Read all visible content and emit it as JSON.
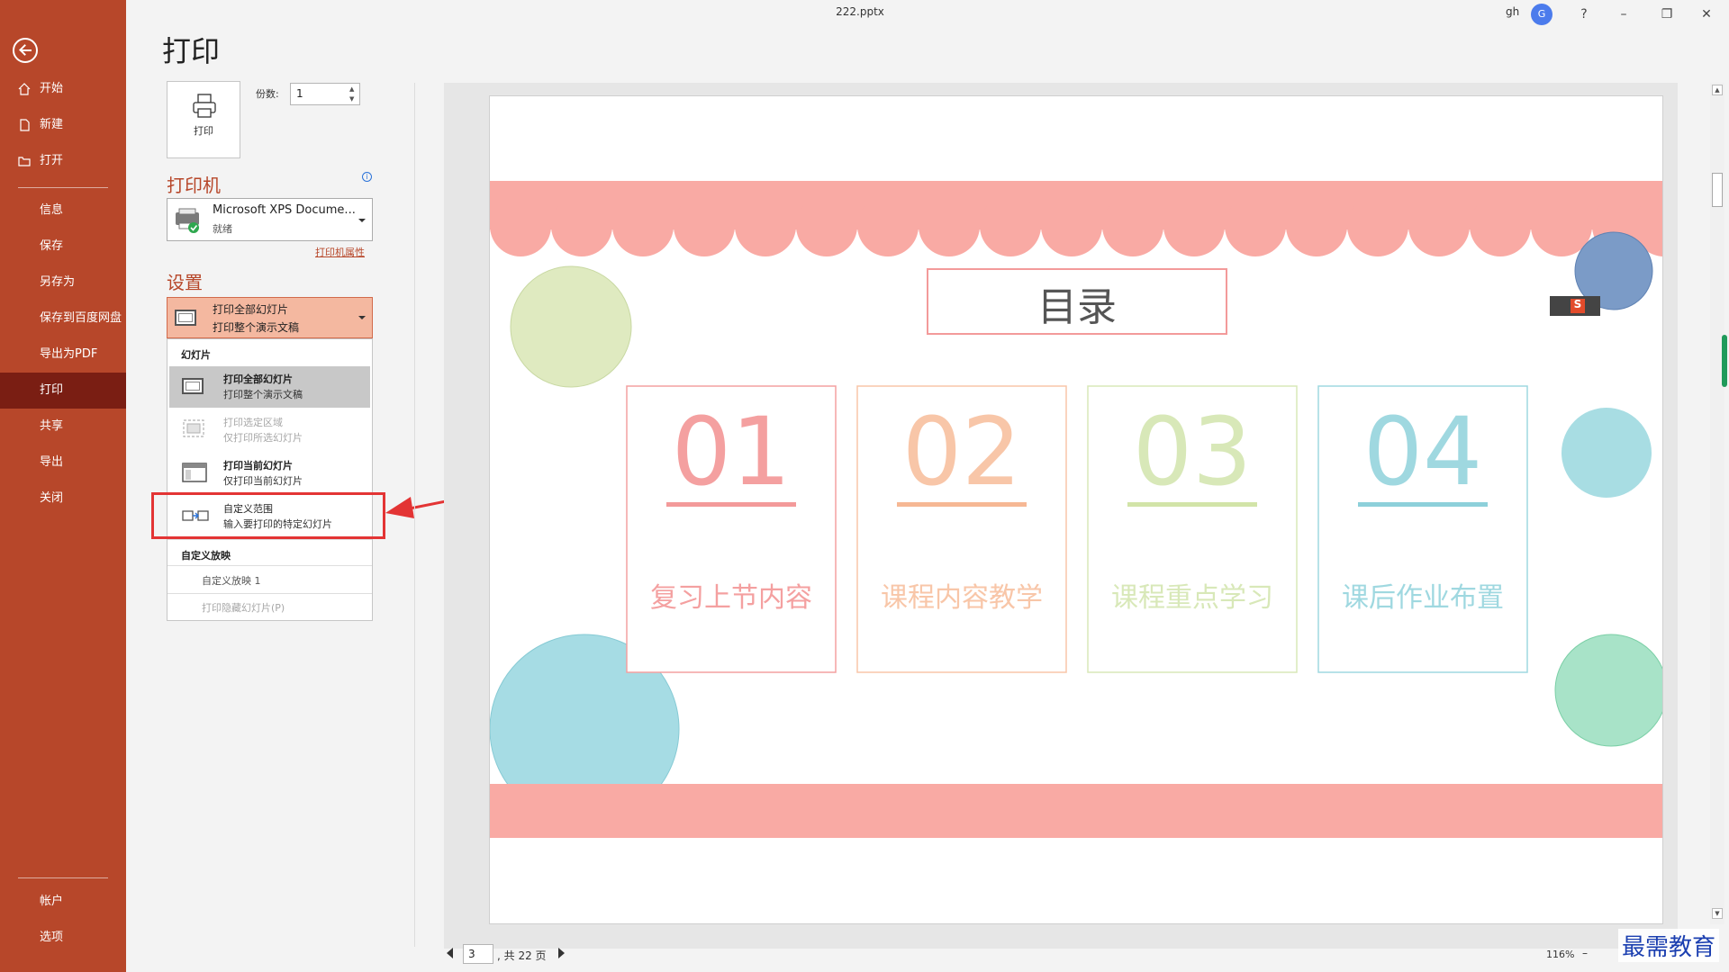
{
  "window": {
    "file_name": "222.pptx",
    "user": "gh",
    "avatar_letter": "G",
    "help": "?",
    "minimize": "–",
    "restore": "❐",
    "close": "✕"
  },
  "nav": {
    "top": [
      {
        "label": "开始",
        "icon": "home-icon"
      },
      {
        "label": "新建",
        "icon": "new-file-icon"
      },
      {
        "label": "打开",
        "icon": "folder-open-icon"
      }
    ],
    "middle": [
      "信息",
      "保存",
      "另存为",
      "保存到百度网盘",
      "导出为PDF",
      "打印",
      "共享",
      "导出",
      "关闭"
    ],
    "selected": "打印",
    "bottom": [
      "帐户",
      "选项"
    ]
  },
  "page_title": "打印",
  "print": {
    "button_label": "打印",
    "copies_label": "份数:",
    "copies_value": "1"
  },
  "printer": {
    "heading": "打印机",
    "name": "Microsoft XPS Docume...",
    "status": "就绪",
    "properties_link": "打印机属性"
  },
  "settings": {
    "heading": "设置",
    "selected_title": "打印全部幻灯片",
    "selected_sub": "打印整个演示文稿"
  },
  "menu": {
    "section_slides": "幻灯片",
    "items": [
      {
        "title": "打印全部幻灯片",
        "sub": "打印整个演示文稿",
        "state": "selected"
      },
      {
        "title": "打印选定区域",
        "sub": "仅打印所选幻灯片",
        "state": "disabled"
      },
      {
        "title": "打印当前幻灯片",
        "sub": "仅打印当前幻灯片",
        "state": "normal"
      },
      {
        "title": "自定义范围",
        "sub": "输入要打印的特定幻灯片",
        "state": "normal"
      }
    ],
    "section_custom": "自定义放映",
    "custom_show": "自定义放映 1",
    "hidden_slides": "打印隐藏幻灯片(P)"
  },
  "slide": {
    "title": "目录",
    "cards": [
      {
        "num": "01",
        "text": "复习上节内容",
        "color": "#f4a0a0",
        "line": "#f39a9a"
      },
      {
        "num": "02",
        "text": "课程内容教学",
        "color": "#f8c6a8",
        "line": "#f6b894"
      },
      {
        "num": "03",
        "text": "课程重点学习",
        "color": "#d8e8b8",
        "line": "#d2e4a8"
      },
      {
        "num": "04",
        "text": "课后作业布置",
        "color": "#9fd8e0",
        "line": "#8dd0da"
      }
    ],
    "badge": "S"
  },
  "page_nav": {
    "current": "3",
    "of_text": ", 共 22 页"
  },
  "zoom": {
    "value": "116%",
    "minus": "–"
  },
  "watermark": "最需教育",
  "colors": {
    "accent": "#b7472a",
    "nav_selected": "#7a1e13",
    "scallop": "#f9aaa4",
    "annotation_red": "#e33434"
  }
}
